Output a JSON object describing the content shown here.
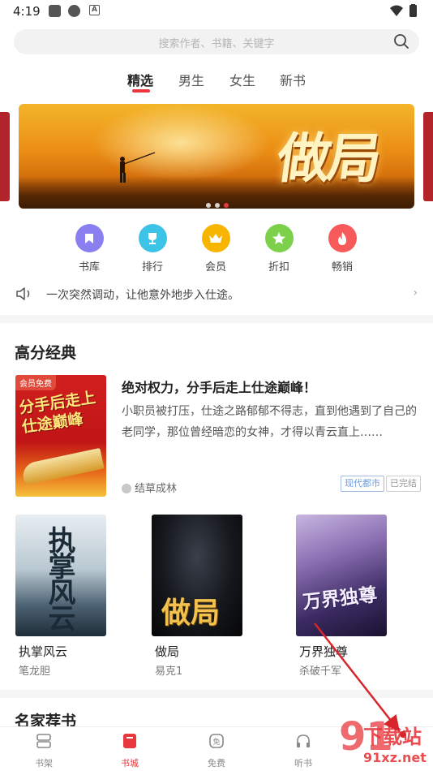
{
  "status_bar": {
    "time": "4:19"
  },
  "search": {
    "placeholder": "搜索作者、书籍、关键字"
  },
  "tabs": [
    {
      "label": "精选",
      "active": true
    },
    {
      "label": "男生",
      "active": false
    },
    {
      "label": "女生",
      "active": false
    },
    {
      "label": "新书",
      "active": false
    }
  ],
  "banner": {
    "title": "做局",
    "dots": 3,
    "active_dot": 3
  },
  "categories": [
    {
      "label": "书库",
      "icon": "bookmark-icon",
      "color": "#8a7ff0"
    },
    {
      "label": "排行",
      "icon": "trophy-icon",
      "color": "#3cc3e6"
    },
    {
      "label": "会员",
      "icon": "crown-icon",
      "color": "#f7b500"
    },
    {
      "label": "折扣",
      "icon": "star-icon",
      "color": "#7dd14a"
    },
    {
      "label": "畅销",
      "icon": "flame-icon",
      "color": "#f65a5a"
    }
  ],
  "notice": {
    "text": "一次突然调动，让他意外地步入仕途。"
  },
  "section_high": {
    "title": "高分经典",
    "featured": {
      "badge": "会员免费",
      "cover_title": "分手后走上仕途巅峰",
      "title": "绝对权力，分手后走上仕途巅峰！",
      "description": "小职员被打压，仕途之路郁郁不得志，直到他遇到了自己的老同学，那位曾经暗恋的女神，才得以青云直上……",
      "author": "结草成林",
      "tags": [
        "现代都市",
        "已完结"
      ]
    },
    "books": [
      {
        "name": "执掌风云",
        "author": "笔龙胆",
        "cover_text": "执掌风云"
      },
      {
        "name": "做局",
        "author": "易克1",
        "cover_text": "做局"
      },
      {
        "name": "万界独尊",
        "author": "杀破千军",
        "cover_text": "万界独尊"
      }
    ]
  },
  "section_next": {
    "title": "名家荐书"
  },
  "bottom_nav": [
    {
      "label": "书架",
      "active": false
    },
    {
      "label": "书城",
      "active": true
    },
    {
      "label": "免费",
      "active": false
    },
    {
      "label": "听书",
      "active": false
    }
  ],
  "watermark": {
    "brand": "下载站",
    "url": "91xz.net",
    "number": "91"
  },
  "colors": {
    "accent": "#e8383d",
    "tag_blue": "#6f9bd8",
    "tag_gray": "#9a9a9a"
  }
}
